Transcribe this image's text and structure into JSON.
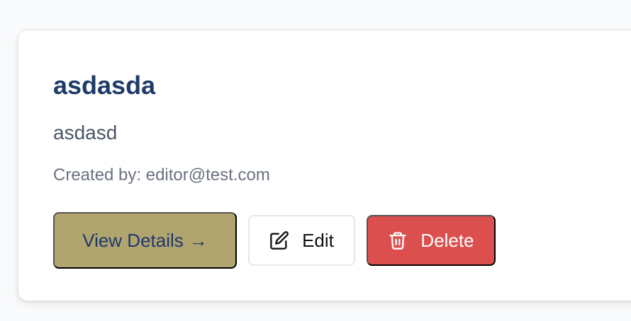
{
  "card": {
    "title": "asdasda",
    "description": "asdasd",
    "created_by": "Created by: editor@test.com"
  },
  "actions": {
    "view_label": "View Details",
    "view_arrow": "→",
    "edit_label": "Edit",
    "edit_icon": "edit-icon",
    "delete_label": "Delete",
    "delete_icon": "trash-icon"
  },
  "colors": {
    "title": "#1e3a6b",
    "view_button_bg": "#b0a46f",
    "delete_button_bg": "#dc4f4f"
  }
}
